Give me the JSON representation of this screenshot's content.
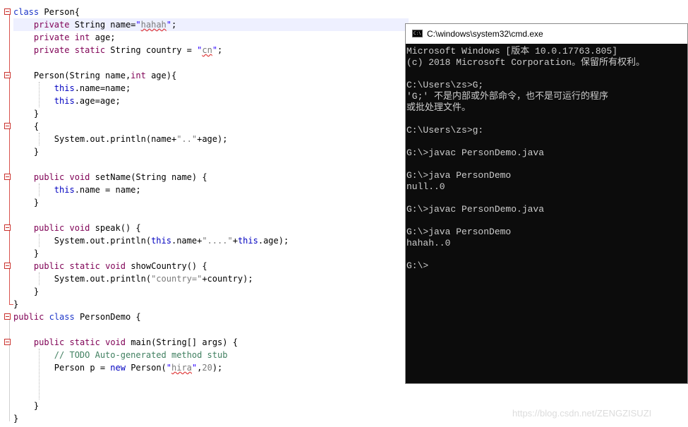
{
  "code": {
    "lines": [
      {
        "parts": [
          {
            "c": "kw2",
            "t": "class"
          },
          {
            "t": " Person{"
          }
        ]
      },
      {
        "parts": [
          {
            "t": "    "
          },
          {
            "c": "kw",
            "t": "private"
          },
          {
            "t": " String name="
          },
          {
            "c": "str",
            "t": "\""
          },
          {
            "c": "strp sq",
            "t": "hahah"
          },
          {
            "c": "str",
            "t": "\""
          },
          {
            "t": ";"
          }
        ]
      },
      {
        "parts": [
          {
            "t": "    "
          },
          {
            "c": "kw",
            "t": "private"
          },
          {
            "t": " "
          },
          {
            "c": "kw",
            "t": "int"
          },
          {
            "t": " age;"
          }
        ]
      },
      {
        "parts": [
          {
            "t": "    "
          },
          {
            "c": "kw",
            "t": "private"
          },
          {
            "t": " "
          },
          {
            "c": "kw",
            "t": "static"
          },
          {
            "t": " String country = "
          },
          {
            "c": "str",
            "t": "\""
          },
          {
            "c": "strp sq",
            "t": "cn"
          },
          {
            "c": "str",
            "t": "\""
          },
          {
            "t": ";"
          }
        ]
      },
      {
        "parts": [
          {
            "t": ""
          }
        ]
      },
      {
        "parts": [
          {
            "t": "    Person(String name,"
          },
          {
            "c": "kw",
            "t": "int"
          },
          {
            "t": " age){"
          }
        ]
      },
      {
        "parts": [
          {
            "t": "        "
          },
          {
            "c": "fld",
            "t": "this"
          },
          {
            "t": ".name=name;"
          }
        ]
      },
      {
        "parts": [
          {
            "t": "        "
          },
          {
            "c": "fld",
            "t": "this"
          },
          {
            "t": ".age=age;"
          }
        ]
      },
      {
        "parts": [
          {
            "t": "    }"
          }
        ]
      },
      {
        "parts": [
          {
            "t": "    {"
          }
        ]
      },
      {
        "parts": [
          {
            "t": "        System.out.println(name+"
          },
          {
            "c": "strp",
            "t": "\"..\""
          },
          {
            "t": "+age);"
          }
        ]
      },
      {
        "parts": [
          {
            "t": "    }"
          }
        ]
      },
      {
        "parts": [
          {
            "t": ""
          }
        ]
      },
      {
        "parts": [
          {
            "t": "    "
          },
          {
            "c": "kw",
            "t": "public"
          },
          {
            "t": " "
          },
          {
            "c": "kw",
            "t": "void"
          },
          {
            "t": " setName(String name) {"
          }
        ]
      },
      {
        "parts": [
          {
            "t": "        "
          },
          {
            "c": "fld",
            "t": "this"
          },
          {
            "t": ".name = name;"
          }
        ]
      },
      {
        "parts": [
          {
            "t": "    }"
          }
        ]
      },
      {
        "parts": [
          {
            "t": ""
          }
        ]
      },
      {
        "parts": [
          {
            "t": "    "
          },
          {
            "c": "kw",
            "t": "public"
          },
          {
            "t": " "
          },
          {
            "c": "kw",
            "t": "void"
          },
          {
            "t": " speak() {"
          }
        ]
      },
      {
        "parts": [
          {
            "t": "        System.out.println("
          },
          {
            "c": "fld",
            "t": "this"
          },
          {
            "t": ".name+"
          },
          {
            "c": "strp",
            "t": "\"....\""
          },
          {
            "t": "+"
          },
          {
            "c": "fld",
            "t": "this"
          },
          {
            "t": ".age);"
          }
        ]
      },
      {
        "parts": [
          {
            "t": "    }"
          }
        ]
      },
      {
        "parts": [
          {
            "t": "    "
          },
          {
            "c": "kw",
            "t": "public"
          },
          {
            "t": " "
          },
          {
            "c": "kw",
            "t": "static"
          },
          {
            "t": " "
          },
          {
            "c": "kw",
            "t": "void"
          },
          {
            "t": " showCountry() {"
          }
        ]
      },
      {
        "parts": [
          {
            "t": "        System.out.println("
          },
          {
            "c": "strp",
            "t": "\"country=\""
          },
          {
            "t": "+country);"
          }
        ]
      },
      {
        "parts": [
          {
            "t": "    }"
          }
        ]
      },
      {
        "parts": [
          {
            "t": "}"
          }
        ]
      },
      {
        "parts": [
          {
            "c": "kw",
            "t": "public"
          },
          {
            "t": " "
          },
          {
            "c": "kw2",
            "t": "class"
          },
          {
            "t": " PersonDemo {"
          }
        ]
      },
      {
        "parts": [
          {
            "t": ""
          }
        ]
      },
      {
        "parts": [
          {
            "t": "    "
          },
          {
            "c": "kw",
            "t": "public"
          },
          {
            "t": " "
          },
          {
            "c": "kw",
            "t": "static"
          },
          {
            "t": " "
          },
          {
            "c": "kw",
            "t": "void"
          },
          {
            "t": " main(String[] args) {"
          }
        ]
      },
      {
        "parts": [
          {
            "t": "        "
          },
          {
            "c": "cmt",
            "t": "// TODO Auto-generated method stub"
          }
        ]
      },
      {
        "parts": [
          {
            "t": "        Person p = "
          },
          {
            "c": "fld",
            "t": "new"
          },
          {
            "t": " Person("
          },
          {
            "c": "str",
            "t": "\""
          },
          {
            "c": "strp sq",
            "t": "hira"
          },
          {
            "c": "str",
            "t": "\""
          },
          {
            "t": ","
          },
          {
            "c": "num",
            "t": "20"
          },
          {
            "t": ");"
          }
        ]
      },
      {
        "parts": [
          {
            "t": ""
          }
        ]
      },
      {
        "parts": [
          {
            "t": ""
          }
        ]
      },
      {
        "parts": [
          {
            "t": "    }"
          }
        ]
      },
      {
        "parts": [
          {
            "t": "}"
          }
        ]
      }
    ]
  },
  "cmd": {
    "title": "C:\\windows\\system32\\cmd.exe",
    "icon": "cmd-icon",
    "lines": [
      "Microsoft Windows [版本 10.0.17763.805]",
      "(c) 2018 Microsoft Corporation。保留所有权利。",
      "",
      "C:\\Users\\zs>G;",
      "'G;' 不是内部或外部命令，也不是可运行的程序",
      "或批处理文件。",
      "",
      "C:\\Users\\zs>g:",
      "",
      "G:\\>javac PersonDemo.java",
      "",
      "G:\\>java PersonDemo",
      "null..0",
      "",
      "G:\\>javac PersonDemo.java",
      "",
      "G:\\>java PersonDemo",
      "hahah..0",
      "",
      "G:\\>"
    ]
  },
  "watermark": "https://blog.csdn.net/ZENGZISUZI"
}
